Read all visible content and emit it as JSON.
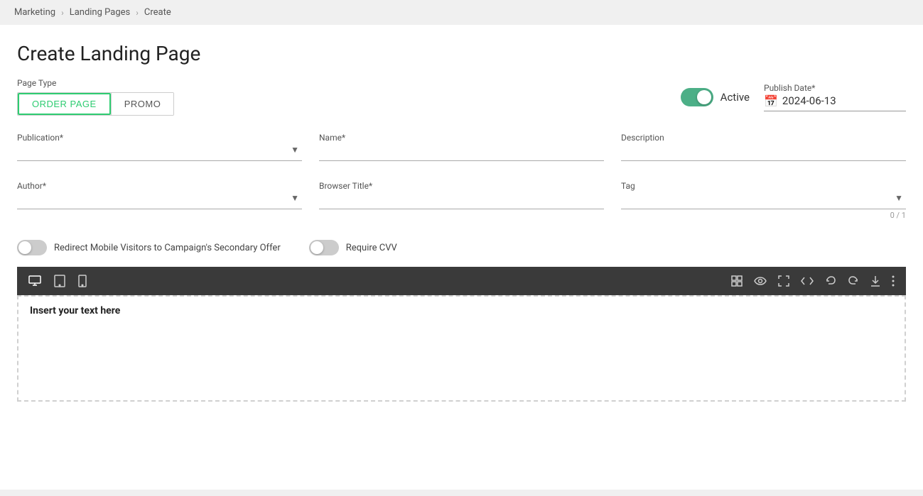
{
  "breadcrumb": {
    "items": [
      {
        "label": "Marketing",
        "link": true
      },
      {
        "label": "Landing Pages",
        "link": true
      },
      {
        "label": "Create",
        "link": false
      }
    ]
  },
  "page": {
    "title": "Create Landing Page",
    "type_label": "Page Type",
    "type_buttons": [
      {
        "label": "ORDER PAGE",
        "active": true
      },
      {
        "label": "PROMO",
        "active": false
      }
    ]
  },
  "active_toggle": {
    "label": "Active",
    "enabled": true
  },
  "publish_date": {
    "label": "Publish Date*",
    "value": "2024-06-13"
  },
  "form": {
    "row1": {
      "publication": {
        "label": "Publication*",
        "value": "",
        "placeholder": ""
      },
      "name": {
        "label": "Name*",
        "value": ""
      },
      "description": {
        "label": "Description",
        "value": ""
      }
    },
    "row2": {
      "author": {
        "label": "Author*",
        "value": ""
      },
      "browser_title": {
        "label": "Browser Title*",
        "value": ""
      },
      "tag": {
        "label": "Tag",
        "value": "",
        "count": "0 / 1"
      }
    }
  },
  "toggles": {
    "redirect": {
      "label": "Redirect Mobile Visitors to Campaign's Secondary Offer",
      "enabled": false
    },
    "require_cvv": {
      "label": "Require CVV",
      "enabled": false
    }
  },
  "editor": {
    "toolbar": {
      "desktop_icon": "🖥",
      "tablet_icon": "▭",
      "mobile_icon": "📱",
      "grid_icon": "⊞",
      "eye_icon": "👁",
      "expand_icon": "⛶",
      "code_icon": "</>",
      "undo_icon": "↩",
      "redo_icon": "↪",
      "download_icon": "⬇",
      "more_icon": "⋮"
    },
    "placeholder": "Insert your text here"
  }
}
